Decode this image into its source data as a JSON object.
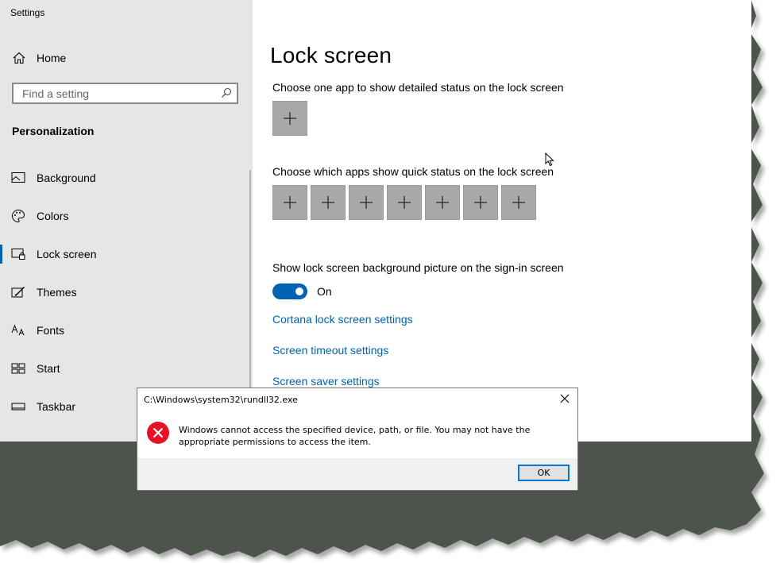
{
  "window": {
    "title": "Settings"
  },
  "sidebar": {
    "home_label": "Home",
    "search_placeholder": "Find a setting",
    "section_title": "Personalization",
    "items": [
      {
        "label": "Background",
        "icon": "image-icon"
      },
      {
        "label": "Colors",
        "icon": "palette-icon"
      },
      {
        "label": "Lock screen",
        "icon": "lock-screen-icon",
        "active": true
      },
      {
        "label": "Themes",
        "icon": "themes-icon"
      },
      {
        "label": "Fonts",
        "icon": "fonts-icon"
      },
      {
        "label": "Start",
        "icon": "start-icon"
      },
      {
        "label": "Taskbar",
        "icon": "taskbar-icon"
      }
    ]
  },
  "content": {
    "title": "Lock screen",
    "detail_label": "Choose one app to show detailed status on the lock screen",
    "quick_label": "Choose which apps show quick status on the lock screen",
    "quick_slot_count": 7,
    "signin_label": "Show lock screen background picture on the sign-in screen",
    "toggle_state": "On",
    "links": {
      "cortana": "Cortana lock screen settings",
      "timeout": "Screen timeout settings",
      "saver": "Screen saver settings"
    }
  },
  "dialog": {
    "title": "C:\\Windows\\system32\\rundll32.exe",
    "message": "Windows cannot access the specified device, path, or file. You may not have the appropriate permissions to access the item.",
    "ok_label": "OK"
  },
  "colors": {
    "accent": "#0063b1",
    "sidebar_bg": "#e6e6e6",
    "backdrop": "#4c544c",
    "error_red": "#e81123"
  }
}
